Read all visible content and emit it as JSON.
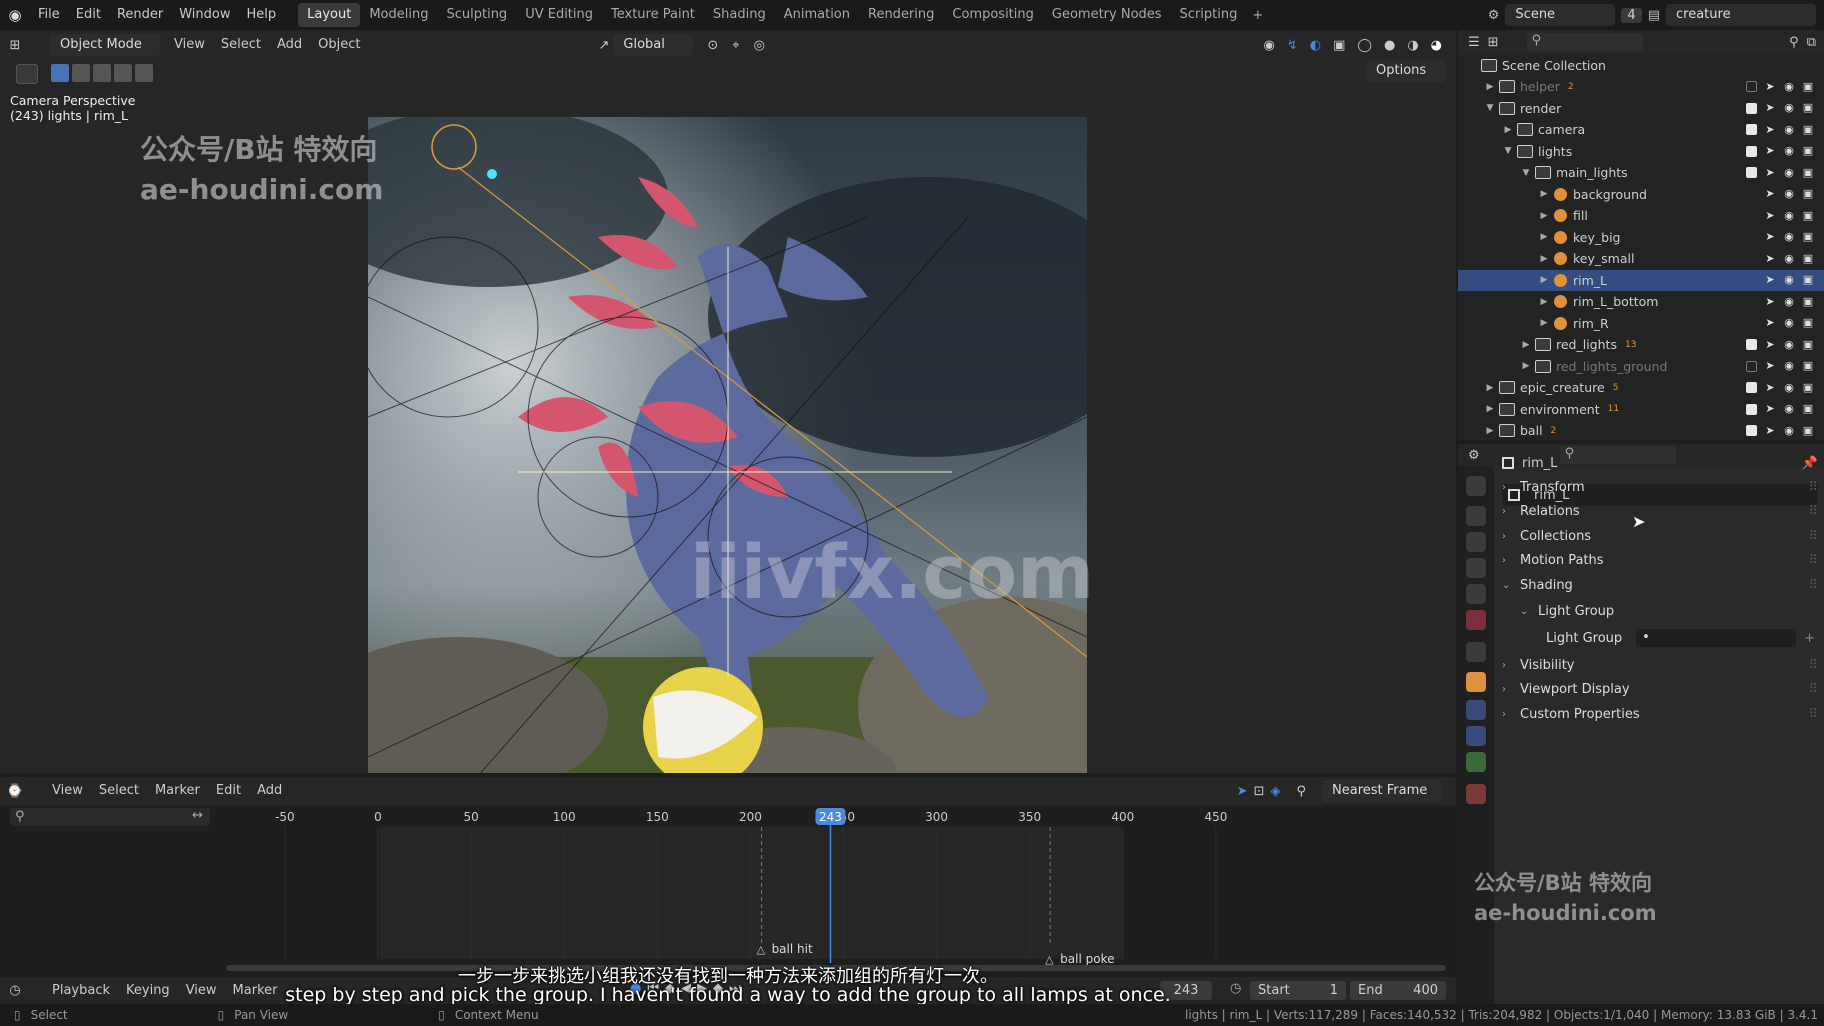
{
  "topbar": {
    "menus": [
      "File",
      "Edit",
      "Render",
      "Window",
      "Help"
    ],
    "workspaces": [
      "Layout",
      "Modeling",
      "Sculpting",
      "UV Editing",
      "Texture Paint",
      "Shading",
      "Animation",
      "Rendering",
      "Compositing",
      "Geometry Nodes",
      "Scripting"
    ],
    "active_workspace": "Layout",
    "scene_label": "Scene",
    "scene_num": "4",
    "view_layer": "creature"
  },
  "viewport_header": {
    "mode": "Object Mode",
    "menus": [
      "View",
      "Select",
      "Add",
      "Object"
    ],
    "transform": "Global",
    "options": "Options"
  },
  "viewport": {
    "camera_label": "Camera Perspective",
    "object_info": "(243) lights | rim_L",
    "watermark_line1": "公众号/B站 特效向",
    "watermark_line2": "ae-houdini.com",
    "watermark_center": "iiivfx.com"
  },
  "outliner": {
    "root": "Scene Collection",
    "rows": [
      {
        "label": "helper",
        "kind": "coll",
        "indent": 1,
        "dim": true,
        "badge": "2"
      },
      {
        "label": "render",
        "kind": "coll",
        "indent": 1,
        "open": true
      },
      {
        "label": "camera",
        "kind": "coll",
        "indent": 2
      },
      {
        "label": "lights",
        "kind": "coll",
        "indent": 2,
        "open": true
      },
      {
        "label": "main_lights",
        "kind": "coll",
        "indent": 3,
        "open": true
      },
      {
        "label": "background",
        "kind": "light",
        "indent": 4
      },
      {
        "label": "fill",
        "kind": "light",
        "indent": 4
      },
      {
        "label": "key_big",
        "kind": "light",
        "indent": 4
      },
      {
        "label": "key_small",
        "kind": "light",
        "indent": 4
      },
      {
        "label": "rim_L",
        "kind": "light",
        "indent": 4,
        "selected": true
      },
      {
        "label": "rim_L_bottom",
        "kind": "light",
        "indent": 4
      },
      {
        "label": "rim_R",
        "kind": "light",
        "indent": 4
      },
      {
        "label": "red_lights",
        "kind": "coll",
        "indent": 3,
        "badge": "13"
      },
      {
        "label": "red_lights_ground",
        "kind": "coll",
        "indent": 3,
        "dim": true
      },
      {
        "label": "epic_creature",
        "kind": "coll",
        "indent": 1,
        "badge": "5"
      },
      {
        "label": "environment",
        "kind": "coll",
        "indent": 1,
        "badge": "11"
      },
      {
        "label": "ball",
        "kind": "coll",
        "indent": 1,
        "badge": "2"
      }
    ]
  },
  "properties": {
    "object_name": "rim_L",
    "datablock_name": "rim_L",
    "sections": [
      "Transform",
      "Relations",
      "Collections",
      "Motion Paths",
      "Shading"
    ],
    "subsection": "Light Group",
    "light_group_label": "Light Group",
    "light_group_value": "•",
    "sections_after": [
      "Visibility",
      "Viewport Display",
      "Custom Properties"
    ],
    "watermark_line1": "公众号/B站 特效向",
    "watermark_line2": "ae-houdini.com"
  },
  "timeline": {
    "menus": [
      "View",
      "Select",
      "Marker",
      "Edit",
      "Add"
    ],
    "snap": "Nearest Frame",
    "ticks": [
      "-50",
      "0",
      "50",
      "100",
      "150",
      "200",
      "250",
      "300",
      "350",
      "400",
      "450"
    ],
    "current_frame": "243",
    "markers": [
      "ball hit",
      "ball poke"
    ]
  },
  "playback_bar": {
    "menus": [
      "Playback",
      "Keying",
      "View",
      "Marker"
    ],
    "frame": "243",
    "start_label": "Start",
    "start": "1",
    "end_label": "End",
    "end": "400"
  },
  "subtitles": {
    "zh": "一步一步来挑选小组我还没有找到一种方法来添加组的所有灯一次。",
    "en": "step by step and pick the group. I haven't found a way to add the group to all lamps at once."
  },
  "statusbar": {
    "select": "Select",
    "pan": "Pan View",
    "context": "Context Menu",
    "stats": "lights | rim_L | Verts:117,289 | Faces:140,532 | Tris:204,982 | Objects:1/1,040 | Memory: 13.83 GiB | 3.4.1"
  },
  "colors": {
    "accent": "#4772b3",
    "selected_row": "#334d80",
    "current_frame": "#4a8be0",
    "light_icon": "#e0913c"
  }
}
